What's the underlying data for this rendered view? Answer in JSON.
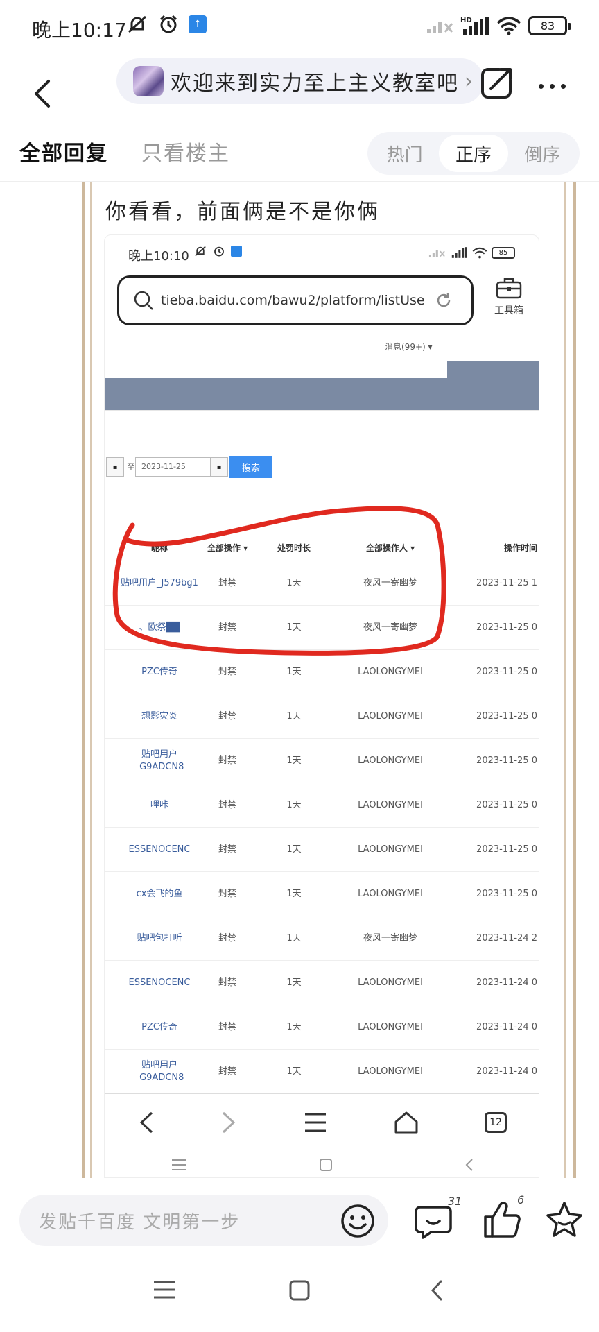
{
  "status": {
    "time": "晚上10:17",
    "battery": "83"
  },
  "nav": {
    "forum_title": "欢迎来到实力至上主义教室吧"
  },
  "tabs": {
    "all_replies": "全部回复",
    "only_op": "只看楼主",
    "sort_options": [
      "热门",
      "正序",
      "倒序"
    ],
    "active_sort": "正序"
  },
  "post": {
    "text": "你看看，前面俩是不是你俩",
    "screenshot": {
      "time": "晚上10:10",
      "battery": "85",
      "url": "tieba.baidu.com/bawu2/platform/listUserL…",
      "toolbox_label": "工具箱",
      "messages": "消息(99+) ▾",
      "date_sep": "至",
      "date_value": "2023-11-25",
      "search_button": "搜索",
      "table": {
        "headers": [
          "昵称",
          "全部操作 ▾",
          "处罚时长",
          "全部操作人 ▾",
          "操作时间"
        ],
        "rows": [
          [
            "贴吧用户_J579bg1",
            "封禁",
            "1天",
            "夜风一寄幽梦",
            "2023-11-25 1"
          ],
          [
            "、欧祭██",
            "封禁",
            "1天",
            "夜风一寄幽梦",
            "2023-11-25 0"
          ],
          [
            "PZC传奇",
            "封禁",
            "1天",
            "LAOLONGYMEI",
            "2023-11-25 0"
          ],
          [
            "想影灾炎",
            "封禁",
            "1天",
            "LAOLONGYMEI",
            "2023-11-25 0"
          ],
          [
            "贴吧用户_G9ADCN8",
            "封禁",
            "1天",
            "LAOLONGYMEI",
            "2023-11-25 0"
          ],
          [
            "哩咔",
            "封禁",
            "1天",
            "LAOLONGYMEI",
            "2023-11-25 0"
          ],
          [
            "ESSENOCENC",
            "封禁",
            "1天",
            "LAOLONGYMEI",
            "2023-11-25 0"
          ],
          [
            "cx会飞的鱼",
            "封禁",
            "1天",
            "LAOLONGYMEI",
            "2023-11-25 0"
          ],
          [
            "贴吧包打听",
            "封禁",
            "1天",
            "夜风一寄幽梦",
            "2023-11-24 2"
          ],
          [
            "ESSENOCENC",
            "封禁",
            "1天",
            "LAOLONGYMEI",
            "2023-11-24 0"
          ],
          [
            "PZC传奇",
            "封禁",
            "1天",
            "LAOLONGYMEI",
            "2023-11-24 0"
          ],
          [
            "贴吧用户_G9ADCN8",
            "封禁",
            "1天",
            "LAOLONGYMEI",
            "2023-11-24 0"
          ]
        ]
      },
      "tab_count": "12"
    }
  },
  "reply_bar": {
    "placeholder": "发贴千百度 文明第一步",
    "comment_count": "31",
    "like_count": "6"
  },
  "colors": {
    "accent_blue": "#3b8ef0",
    "banner": "#7b8aa3",
    "annotation_red": "#e0291f",
    "frame": "#cdb89c"
  }
}
